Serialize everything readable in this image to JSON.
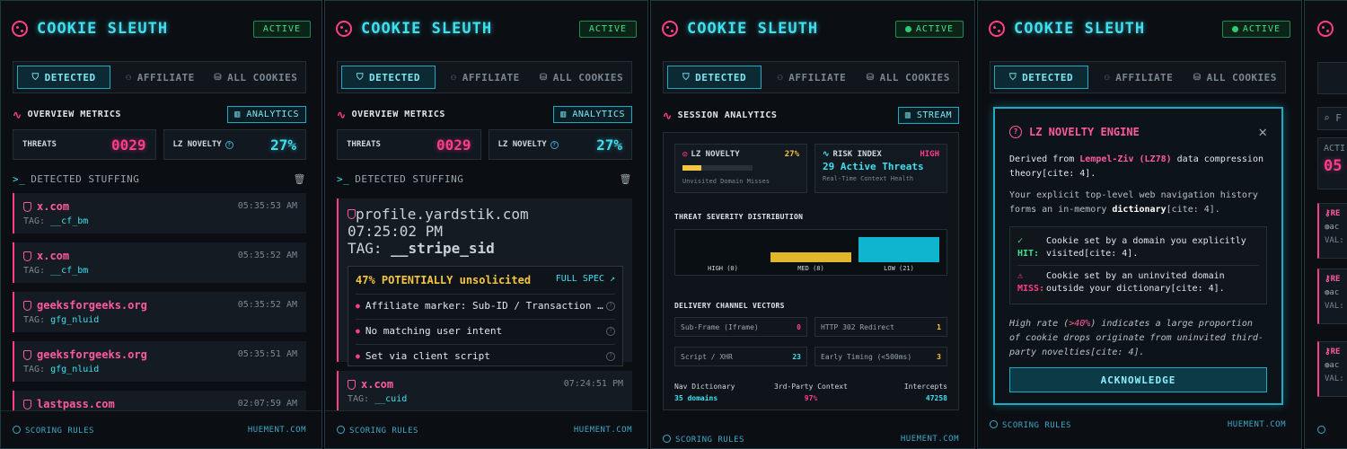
{
  "app": {
    "title": "COOKIE SLEUTH",
    "status": "ACTIVE",
    "footer_left": "SCORING RULES",
    "footer_right": "HUEMENT.COM"
  },
  "tabs": [
    "DETECTED",
    "AFFILIATE",
    "ALL COOKIES"
  ],
  "colors": {
    "accent": "#3fe0f0",
    "alert": "#ff3d8b",
    "ok": "#3ee08a",
    "warn": "#f5c542"
  },
  "panel1": {
    "section": "OVERVIEW METRICS",
    "chip": "ANALYTICS",
    "threats_label": "THREATS",
    "threats_value": "0029",
    "novelty_label": "LZ NOVELTY",
    "novelty_value": "27%",
    "list_title": "DETECTED STUFFING",
    "items": [
      {
        "domain": "x.com",
        "time": "05:35:53 AM",
        "tag_label": "TAG:",
        "tag": "__cf_bm"
      },
      {
        "domain": "x.com",
        "time": "05:35:52 AM",
        "tag_label": "TAG:",
        "tag": "__cf_bm"
      },
      {
        "domain": "geeksforgeeks.org",
        "time": "05:35:52 AM",
        "tag_label": "TAG:",
        "tag": "gfg_nluid"
      },
      {
        "domain": "geeksforgeeks.org",
        "time": "05:35:51 AM",
        "tag_label": "TAG:",
        "tag": "gfg_nluid"
      },
      {
        "domain": "lastpass.com",
        "time": "02:07:59 AM",
        "tag_label": "TAG:",
        "tag": ""
      }
    ]
  },
  "panel2": {
    "section": "OVERVIEW METRICS",
    "chip": "ANALYTICS",
    "threats_label": "THREATS",
    "threats_value": "0029",
    "novelty_label": "LZ NOVELTY",
    "novelty_value": "27%",
    "list_title": "DETECTED STUFFING",
    "expanded": {
      "domain": "profile.yardstik.com",
      "time": "07:25:02 PM",
      "tag_label": "TAG:",
      "tag": "__stripe_sid",
      "headline": "47% POTENTIALLY unsolicited",
      "link": "FULL SPEC",
      "reasons": [
        "Affiliate marker: Sub-ID / Transaction …",
        "No matching user intent",
        "Set via client script"
      ]
    },
    "next": {
      "domain": "x.com",
      "time": "07:24:51 PM",
      "tag_label": "TAG:",
      "tag": "__cuid"
    }
  },
  "panel3": {
    "section": "SESSION ANALYTICS",
    "chip": "STREAM",
    "novelty": {
      "label": "LZ NOVELTY",
      "value": "27%",
      "fraction": 0.27,
      "sub": "Unvisited Domain Misses"
    },
    "risk": {
      "label": "RISK INDEX",
      "level": "HIGH",
      "value": "29 Active Threats",
      "sub": "Real-Time Context Health"
    },
    "severity_title": "THREAT SEVERITY DISTRIBUTION",
    "severity": [
      {
        "label": "HIGH (0)",
        "count": 0,
        "color": "#ff3d8b"
      },
      {
        "label": "MED (8)",
        "count": 8,
        "color": "#e0b62a"
      },
      {
        "label": "LOW (21)",
        "count": 21,
        "color": "#0fb4cf"
      }
    ],
    "vectors_title": "DELIVERY CHANNEL VECTORS",
    "vectors": [
      {
        "label": "Sub-Frame (Iframe)",
        "value": "0",
        "color": "#ff3d8b"
      },
      {
        "label": "HTTP 302 Redirect",
        "value": "1",
        "color": "#f5c542"
      },
      {
        "label": "Script / XHR",
        "value": "23",
        "color": "#3fe0f0"
      },
      {
        "label": "Early Timing (<500ms)",
        "value": "3",
        "color": "#f5c542"
      }
    ],
    "stats": [
      {
        "label": "Nav Dictionary",
        "value": "35 domains",
        "color": "#3fe0f0"
      },
      {
        "label": "3rd-Party Context",
        "value": "97%",
        "color": "#ff3d8b"
      },
      {
        "label": "Intercepts",
        "value": "47258",
        "color": "#3fe0f0"
      }
    ]
  },
  "panel4": {
    "modal_title": "LZ NOVELTY ENGINE",
    "p1_pre": "Derived from ",
    "p1_hl": "Lempel-Ziv (LZ78)",
    "p1_post": " data compression theory[cite: 4].",
    "p2_pre": "Your explicit top-level web navigation history forms an in-memory ",
    "p2_b": "dictionary",
    "p2_post": "[cite: 4].",
    "hit_key": "HIT:",
    "hit_text": "Cookie set by a domain you explicitly visited[cite: 4].",
    "miss_key": "MISS:",
    "miss_text": "Cookie set by an uninvited domain outside your dictionary[cite: 4].",
    "p3_pre": "High rate (",
    "p3_pk": ">40%",
    "p3_post": ") indicates a large proportion of cookie drops originate from uninvited third-party novelties[cite: 4].",
    "button": "ACKNOWLEDGE"
  },
  "panel5": {
    "snippets": [
      "F",
      "ACTI",
      "05",
      "RE",
      "ac",
      "VAL:",
      "RE",
      "ac",
      "VAL:",
      "RE",
      "ac",
      "VAL:"
    ]
  }
}
